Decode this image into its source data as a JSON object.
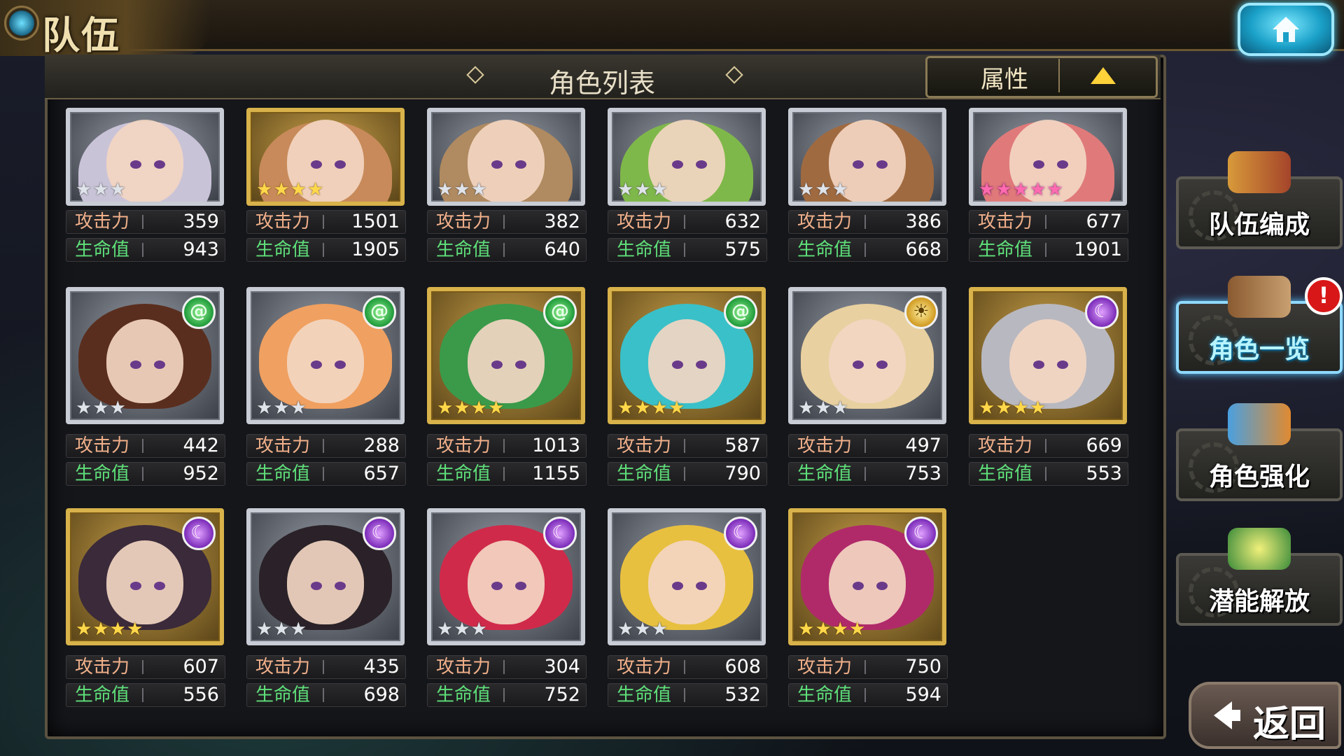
{
  "header": {
    "title": "队伍"
  },
  "panel": {
    "title": "角色列表",
    "sort_label": "属性"
  },
  "colors": {
    "atk_label": "#f1b08a",
    "hp_label": "#5fe07a",
    "accent_cyan": "#5ac6ff"
  },
  "stat_labels": {
    "atk": "攻击力",
    "hp": "生命值"
  },
  "characters": [
    {
      "atk": "359",
      "hp": "943",
      "stars": 3,
      "frame": "silver",
      "element": "",
      "hair": "#c9c3d8"
    },
    {
      "atk": "1501",
      "hp": "1905",
      "stars": 4,
      "frame": "gold",
      "element": "",
      "hair": "#c88a5a"
    },
    {
      "atk": "382",
      "hp": "640",
      "stars": 3,
      "frame": "silver",
      "element": "",
      "hair": "#b08a60"
    },
    {
      "atk": "632",
      "hp": "575",
      "stars": 3,
      "frame": "silver",
      "element": "",
      "hair": "#7fb84a"
    },
    {
      "atk": "386",
      "hp": "668",
      "stars": 3,
      "frame": "silver",
      "element": "",
      "hair": "#a06a40"
    },
    {
      "atk": "677",
      "hp": "1901",
      "stars": 5,
      "frame": "rainbow",
      "element": "",
      "hair": "#e07a7a"
    },
    {
      "atk": "442",
      "hp": "952",
      "stars": 3,
      "frame": "silver",
      "element": "wind",
      "hair": "#5a2e1e"
    },
    {
      "atk": "288",
      "hp": "657",
      "stars": 3,
      "frame": "silver",
      "element": "wind",
      "hair": "#f0a060"
    },
    {
      "atk": "1013",
      "hp": "1155",
      "stars": 4,
      "frame": "gold",
      "element": "wind",
      "hair": "#3a9a4a"
    },
    {
      "atk": "587",
      "hp": "790",
      "stars": 4,
      "frame": "gold",
      "element": "wind",
      "hair": "#3ac0c8"
    },
    {
      "atk": "497",
      "hp": "753",
      "stars": 3,
      "frame": "silver",
      "element": "sun",
      "hair": "#e8d0a0"
    },
    {
      "atk": "669",
      "hp": "553",
      "stars": 4,
      "frame": "gold",
      "element": "moon",
      "hair": "#b8b8c0"
    },
    {
      "atk": "607",
      "hp": "556",
      "stars": 4,
      "frame": "gold",
      "element": "moon",
      "hair": "#3a2a3a"
    },
    {
      "atk": "435",
      "hp": "698",
      "stars": 3,
      "frame": "silver",
      "element": "moon",
      "hair": "#2a2228"
    },
    {
      "atk": "304",
      "hp": "752",
      "stars": 3,
      "frame": "silver",
      "element": "moon",
      "hair": "#d02a4a"
    },
    {
      "atk": "608",
      "hp": "532",
      "stars": 3,
      "frame": "silver",
      "element": "moon",
      "hair": "#e8c040"
    },
    {
      "atk": "750",
      "hp": "594",
      "stars": 4,
      "frame": "gold",
      "element": "moon",
      "hair": "#b02a6a"
    }
  ],
  "side_menu": [
    {
      "label": "队伍编成",
      "icon": "team-chibi-icon",
      "active": false
    },
    {
      "label": "角色一览",
      "icon": "book-icon",
      "active": true
    },
    {
      "label": "角色强化",
      "icon": "enhance-card-icon",
      "active": false
    },
    {
      "label": "潜能解放",
      "icon": "potential-orb-icon",
      "active": false
    }
  ],
  "alert": {
    "text": "!"
  },
  "back": {
    "label": "返回"
  }
}
